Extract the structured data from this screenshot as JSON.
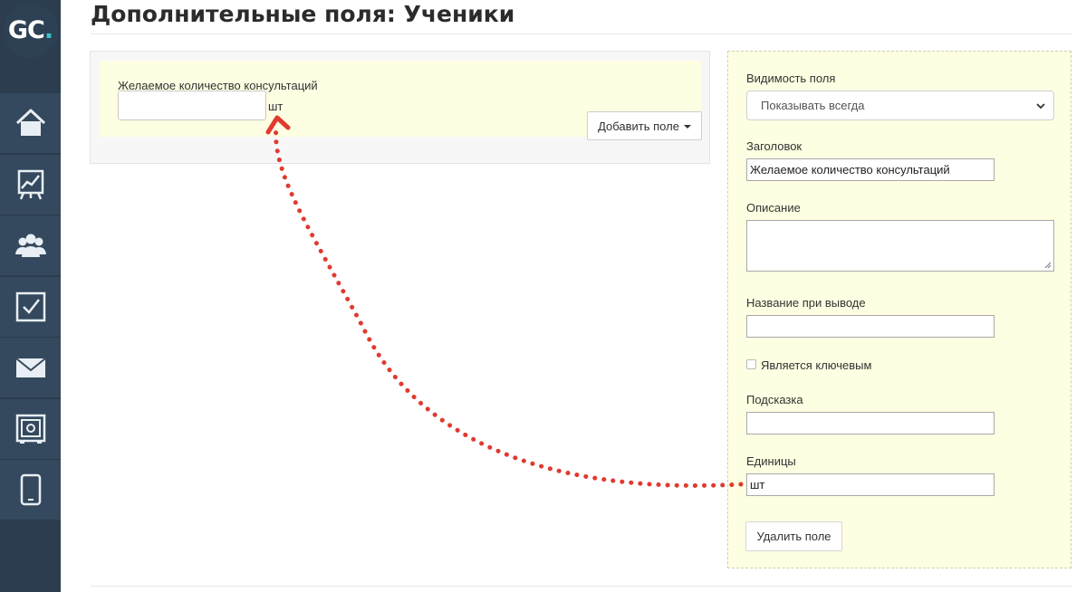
{
  "app": {
    "logo_text_g": "G",
    "logo_text_c": "C",
    "logo_text_dot": ".",
    "accent_color": "#3cc3c9"
  },
  "sidebar": {
    "items": [
      {
        "icon": "home-icon"
      },
      {
        "icon": "chart-presentation-icon"
      },
      {
        "icon": "users-icon"
      },
      {
        "icon": "checkbox-icon"
      },
      {
        "icon": "mail-icon"
      },
      {
        "icon": "safe-icon"
      },
      {
        "icon": "mobile-phone-icon"
      }
    ]
  },
  "page": {
    "title": "Дополнительные поля: Ученики"
  },
  "preview": {
    "field_label": "Желаемое количество консультаций",
    "input_value": "",
    "unit": "шт",
    "add_field_label": "Добавить поле"
  },
  "settings": {
    "visibility_label": "Видимость поля",
    "visibility_value": "Показывать всегда",
    "heading_label": "Заголовок",
    "heading_value": "Желаемое количество консультаций",
    "description_label": "Описание",
    "description_value": "",
    "display_name_label": "Название при выводе",
    "display_name_value": "",
    "is_key_label": "Является ключевым",
    "is_key_checked": false,
    "hint_label": "Подсказка",
    "hint_value": "",
    "units_label": "Единицы",
    "units_value": "шт",
    "delete_label": "Удалить поле"
  },
  "annotation": {
    "arrow_color": "#e03a2f"
  }
}
